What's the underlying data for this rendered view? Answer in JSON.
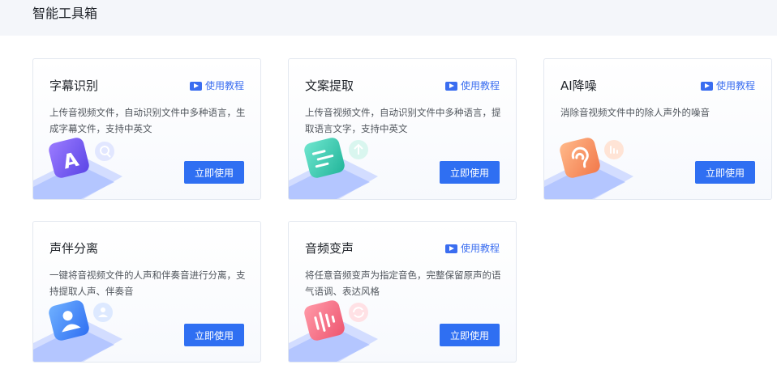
{
  "page": {
    "title": "智能工具箱"
  },
  "tutorial_label": "使用教程",
  "use_label": "立即使用",
  "colors": {
    "accent": "#2f6ff2",
    "link": "#3a6df0"
  },
  "tools": [
    {
      "title": "字幕识别",
      "desc": "上传音视频文件，自动识别文件中多种语言，生成字幕文件，支持中英文",
      "icon": "subtitle-a-icon",
      "has_tutorial": true
    },
    {
      "title": "文案提取",
      "desc": "上传音视频文件，自动识别文件中多种语言，提取语言文字，支持中英文",
      "icon": "text-extract-icon",
      "has_tutorial": true
    },
    {
      "title": "AI降噪",
      "desc": "消除音视频文件中的除人声外的噪音",
      "icon": "ear-icon",
      "has_tutorial": true
    },
    {
      "title": "声伴分离",
      "desc": "一键将音视频文件的人声和伴奏音进行分离，支持提取人声、伴奏音",
      "icon": "person-icon",
      "has_tutorial": false
    },
    {
      "title": "音频变声",
      "desc": "将任意音频变声为指定音色，完整保留原声的语气语调、表达风格",
      "icon": "voice-wave-icon",
      "has_tutorial": true
    }
  ]
}
